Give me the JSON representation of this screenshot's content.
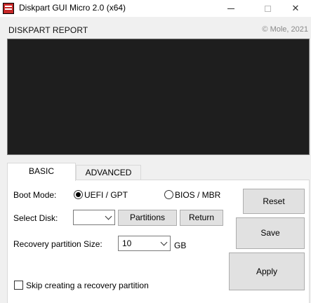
{
  "window": {
    "title": "Diskpart GUI Micro 2.0 (x64)",
    "minimize_glyph": "",
    "maximize_glyph": "",
    "close_glyph": "✕"
  },
  "report": {
    "label": "DISKPART REPORT",
    "copyright": "© Mole, 2021"
  },
  "tabs": [
    {
      "label": "BASIC",
      "selected": true
    },
    {
      "label": "ADVANCED",
      "selected": false
    }
  ],
  "basic": {
    "boot_mode_label": "Boot Mode:",
    "boot_mode_options": [
      {
        "label": "UEFI / GPT",
        "checked": true
      },
      {
        "label": "BIOS / MBR",
        "checked": false
      }
    ],
    "select_disk_label": "Select Disk:",
    "select_disk_value": "",
    "partitions_button": "Partitions",
    "return_button": "Return",
    "recovery_size_label": "Recovery partition Size:",
    "recovery_size_value": "10",
    "recovery_size_unit": "GB",
    "skip_recovery_label": "Skip creating a recovery partition",
    "skip_recovery_checked": false
  },
  "actions": {
    "reset": "Reset",
    "save": "Save",
    "apply": "Apply"
  }
}
